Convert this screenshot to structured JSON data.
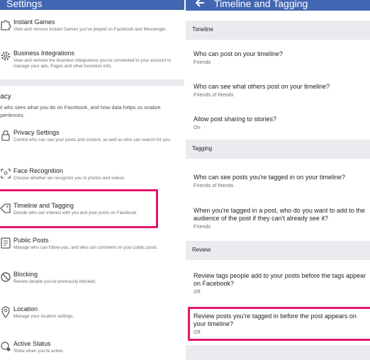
{
  "left": {
    "title": "Settings",
    "items_top": [
      {
        "key": "instant-games",
        "icon": "puzzle-icon",
        "title": "Instant Games",
        "desc": "View and remove Instant Games you've played on Facebook and Messenger."
      },
      {
        "key": "business-integrations",
        "icon": "gear-icon",
        "title": "Business Integrations",
        "desc": "View and remove the business integrations you've connected to your account to manage your ads, Pages and other business info."
      }
    ],
    "privacy": {
      "title": "ivacy",
      "desc": "trol who sees what you do on Facebook, and how data helps us onalize experiences."
    },
    "items": [
      {
        "key": "privacy-settings",
        "icon": "lock-icon",
        "title": "Privacy Settings",
        "desc": "Control who can see your posts and content, as well as who can search for you."
      },
      {
        "key": "face-recognition",
        "icon": "face-icon",
        "title": "Face Recognition",
        "desc": "Choose whether we recognize you in photos and videos."
      },
      {
        "key": "timeline-tagging",
        "icon": "tag-icon",
        "title": "Timeline and Tagging",
        "desc": "Decide who can interact with you and your posts on Facebook."
      },
      {
        "key": "public-posts",
        "icon": "post-icon",
        "title": "Public Posts",
        "desc": "Manage who can follow you, and who can comment on your public posts."
      },
      {
        "key": "blocking",
        "icon": "block-icon",
        "title": "Blocking",
        "desc": "Review people you've previously blocked."
      },
      {
        "key": "location",
        "icon": "location-pin-icon",
        "title": "Location",
        "desc": "Manage your location settings."
      },
      {
        "key": "active-status",
        "icon": "active-status-icon",
        "title": "Active Status",
        "desc": "Show when you're active."
      }
    ]
  },
  "right": {
    "title": "Timeline and Tagging",
    "sections": [
      {
        "header": "Timeline",
        "items": [
          {
            "q": "Who can post on your timeline?",
            "v": "Friends"
          },
          {
            "q": "Who can see what others post on your timeline?",
            "v": "Friends of friends"
          },
          {
            "q": "Allow post sharing to stories?",
            "v": "On"
          }
        ]
      },
      {
        "header": "Tagging",
        "items": [
          {
            "q": "Who can see posts you're tagged in on your timeline?",
            "v": "Friends of friends"
          },
          {
            "q": "When you're tagged in a post, who do you want to add to the audience of the post if they can't already see it?",
            "v": "Friends"
          }
        ]
      },
      {
        "header": "Review",
        "items": [
          {
            "q": "Review tags people add to your posts before the tags appear on Facebook?",
            "v": "Off"
          },
          {
            "q": "Review posts you're tagged in before the post appears on your timeline?",
            "v": "Off"
          }
        ]
      }
    ]
  },
  "colors": {
    "appbar": "#4267b2",
    "highlight": "#e3176b",
    "section_bg": "#e9ebee"
  }
}
